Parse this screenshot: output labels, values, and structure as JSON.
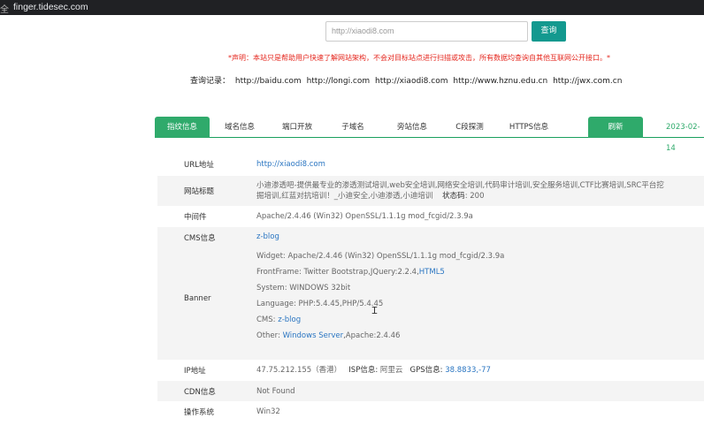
{
  "browser": {
    "url": "finger.tidesec.com",
    "lock_glyph": "全"
  },
  "search": {
    "placeholder": "http://xiaodi8.com",
    "button": "查询"
  },
  "notice": "*声明：本站只是帮助用户快速了解网站架构，不会对目标站点进行扫描或攻击，所有数据均查询自其他互联网公开接口。*",
  "history": {
    "label": "查询记录：",
    "items": [
      "http://baidu.com",
      "http://longi.com",
      "http://xiaodi8.com",
      "http://www.hznu.edu.cn",
      "http://jwx.com.cn"
    ]
  },
  "tabs": [
    {
      "label": "指纹信息",
      "active": true
    },
    {
      "label": "域名信息"
    },
    {
      "label": "端口开放"
    },
    {
      "label": "子域名"
    },
    {
      "label": "旁站信息"
    },
    {
      "label": "C段探测"
    },
    {
      "label": "HTTPS信息"
    }
  ],
  "refresh": "刷新",
  "date": "2023-02-14",
  "rows": {
    "url": {
      "label": "URL地址",
      "value": "http://xiaodi8.com"
    },
    "title": {
      "label": "网站标题",
      "value": "小迪渗透吧-提供最专业的渗透测试培训,web安全培训,网络安全培训,代码审计培训,安全服务培训,CTF比赛培训,SRC平台挖掘培训,红蓝对抗培训！_小迪安全,小迪渗透,小迪培训",
      "status_label": "状态码",
      "status": "200"
    },
    "middleware": {
      "label": "中间件",
      "value": "Apache/2.4.46 (Win32) OpenSSL/1.1.1g mod_fcgid/2.3.9a"
    },
    "cms": {
      "label": "CMS信息",
      "value": "z-blog"
    },
    "banner": {
      "label": "Banner",
      "widget": "Widget: Apache/2.4.46 (Win32) OpenSSL/1.1.1g mod_fcgid/2.3.9a",
      "frontframe": "FrontFrame: Twitter Bootstrap,JQuery:2.2.4,",
      "frontframe_link": "HTML5",
      "system": "System: WINDOWS 32bit",
      "language": "Language: PHP:5.4.45,PHP/5.4.45",
      "cms_prefix": "CMS: ",
      "cms_link": "z-blog",
      "other_prefix": "Other: ",
      "other_link": "Windows Server",
      "other_suffix": ",Apache:2.4.46"
    },
    "ip": {
      "label": "IP地址",
      "value": "47.75.212.155（香港）",
      "isp_label": "ISP信息:",
      "isp": "阿里云",
      "gps_label": "GPS信息:",
      "gps": "38.8833,-77"
    },
    "cdn": {
      "label": "CDN信息",
      "value": "Not Found"
    },
    "os": {
      "label": "操作系统",
      "value": "Win32"
    }
  }
}
